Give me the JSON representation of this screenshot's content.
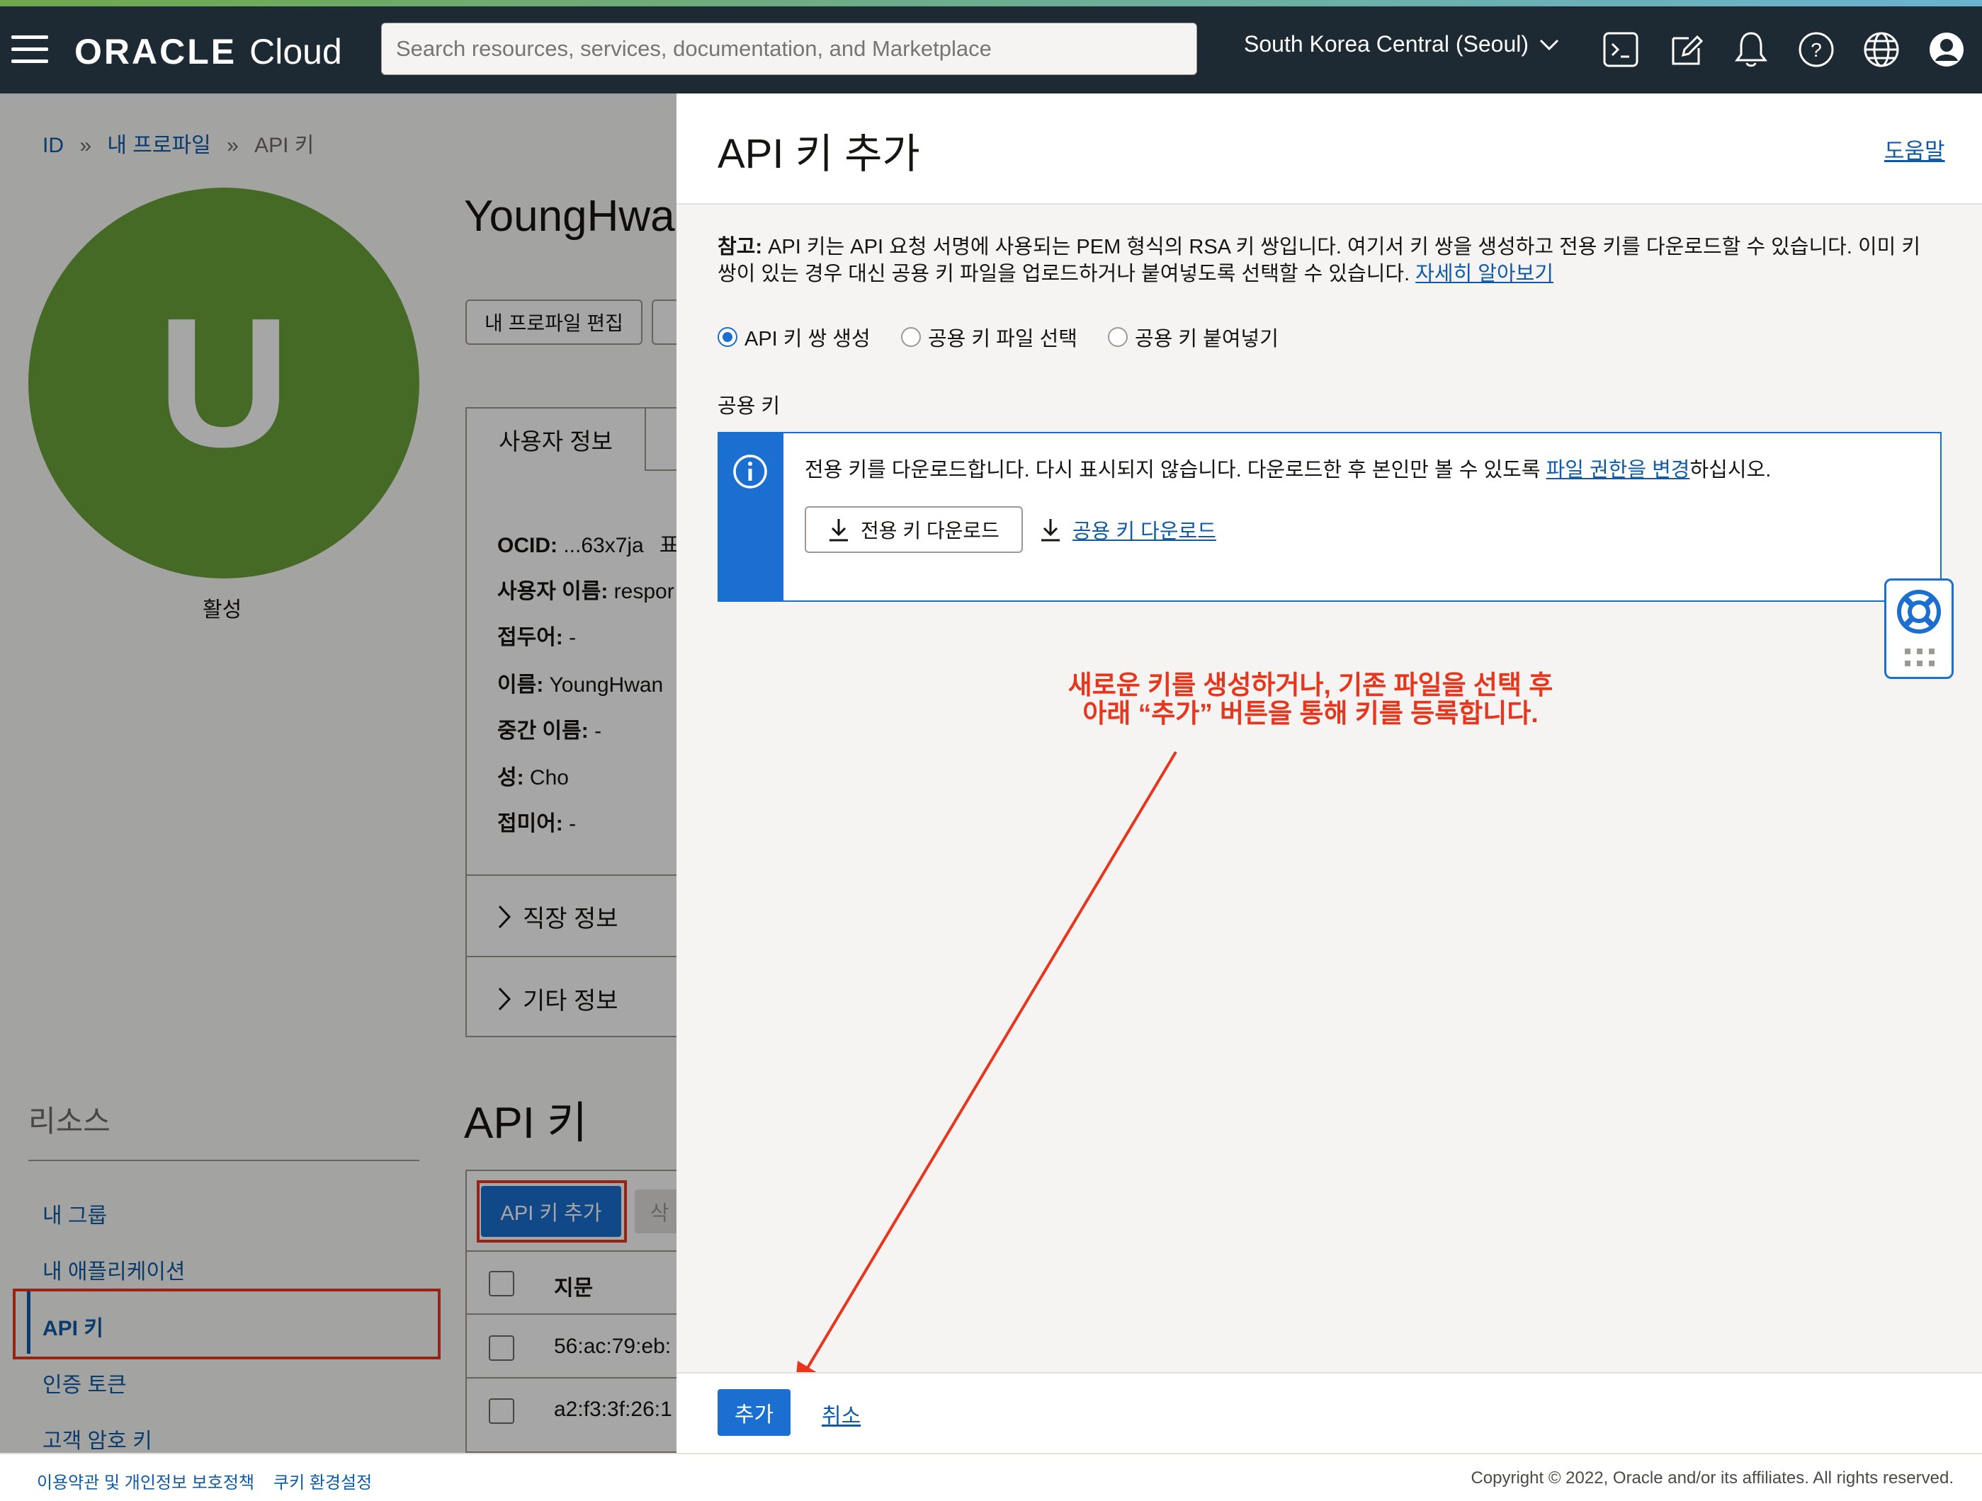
{
  "nav": {
    "logo_brand": "ORACLE",
    "logo_product": "Cloud",
    "search_placeholder": "Search resources, services, documentation, and Marketplace",
    "region": "South Korea Central (Seoul)"
  },
  "breadcrumb": {
    "items": [
      "ID",
      "내 프로파일",
      "API 키"
    ],
    "separator": "»"
  },
  "profile": {
    "avatar_letter": "U",
    "status": "활성",
    "name": "YoungHwa",
    "edit_button": "내 프로파일 편집",
    "tab_user_info": "사용자 정보",
    "fields": [
      {
        "label": "OCID:",
        "value": " ...63x7ja"
      },
      {
        "label": "사용자 이름:",
        "value": " respor"
      },
      {
        "label": "접두어:",
        "value": " -"
      },
      {
        "label": "이름:",
        "value": " YoungHwan"
      },
      {
        "label": "중간 이름:",
        "value": " -"
      },
      {
        "label": "성:",
        "value": " Cho"
      },
      {
        "label": "접미어:",
        "value": " -"
      }
    ],
    "ocid_suffix": "표",
    "sections": [
      "직장 정보",
      "기타 정보"
    ]
  },
  "resources": {
    "title": "리소스",
    "items": [
      "내 그룹",
      "내 애플리케이션",
      "API 키",
      "인증 토큰",
      "고객 암호 키"
    ]
  },
  "api_keys": {
    "title": "API 키",
    "add_button": "API 키 추가",
    "delete_button": "삭",
    "column_fingerprint": "지문",
    "rows": [
      "56:ac:79:eb:",
      "a2:f3:3f:26:1"
    ]
  },
  "drawer": {
    "title": "API 키 추가",
    "help_link": "도움말",
    "note_bold": "참고:",
    "note_text": " API 키는 API 요청 서명에 사용되는 PEM 형식의 RSA 키 쌍입니다. 여기서 키 쌍을 생성하고 전용 키를 다운로드할 수 있습니다. 이미 키 쌍이 있는 경우 대신 공용 키 파일을 업로드하거나 붙여넣도록 선택할 수 있습니다. ",
    "note_link": "자세히 알아보기",
    "options": [
      "API 키 쌍 생성",
      "공용 키 파일 선택",
      "공용 키 붙여넣기"
    ],
    "selected_option": "API 키 쌍 생성",
    "public_key_label": "공용 키",
    "info_text_before": "전용 키를 다운로드합니다. 다시 표시되지 않습니다. 다운로드한 후 본인만 볼 수 있도록 ",
    "info_link": "파일 권한을 변경",
    "info_text_after": "하십시오.",
    "download_private": "전용 키 다운로드",
    "download_public": "공용 키 다운로드",
    "add_button": "추가",
    "cancel_link": "취소"
  },
  "annotation": {
    "line1": "새로운 키를 생성하거나, 기존 파일을 선택 후",
    "line2": "아래 “추가” 버튼을 통해 키를 등록합니다."
  },
  "footer": {
    "terms": "이용약관 및 개인정보 보호정책",
    "cookies": "쿠키 환경설정",
    "copyright": "Copyright © 2022, Oracle and/or its affiliates. All rights reserved."
  },
  "colors": {
    "nav_bg": "#1e2a33",
    "accent": "#1b6fd1",
    "link": "#0f5ba7",
    "avatar": "#6ba43a",
    "annotation": "#e8361d"
  }
}
